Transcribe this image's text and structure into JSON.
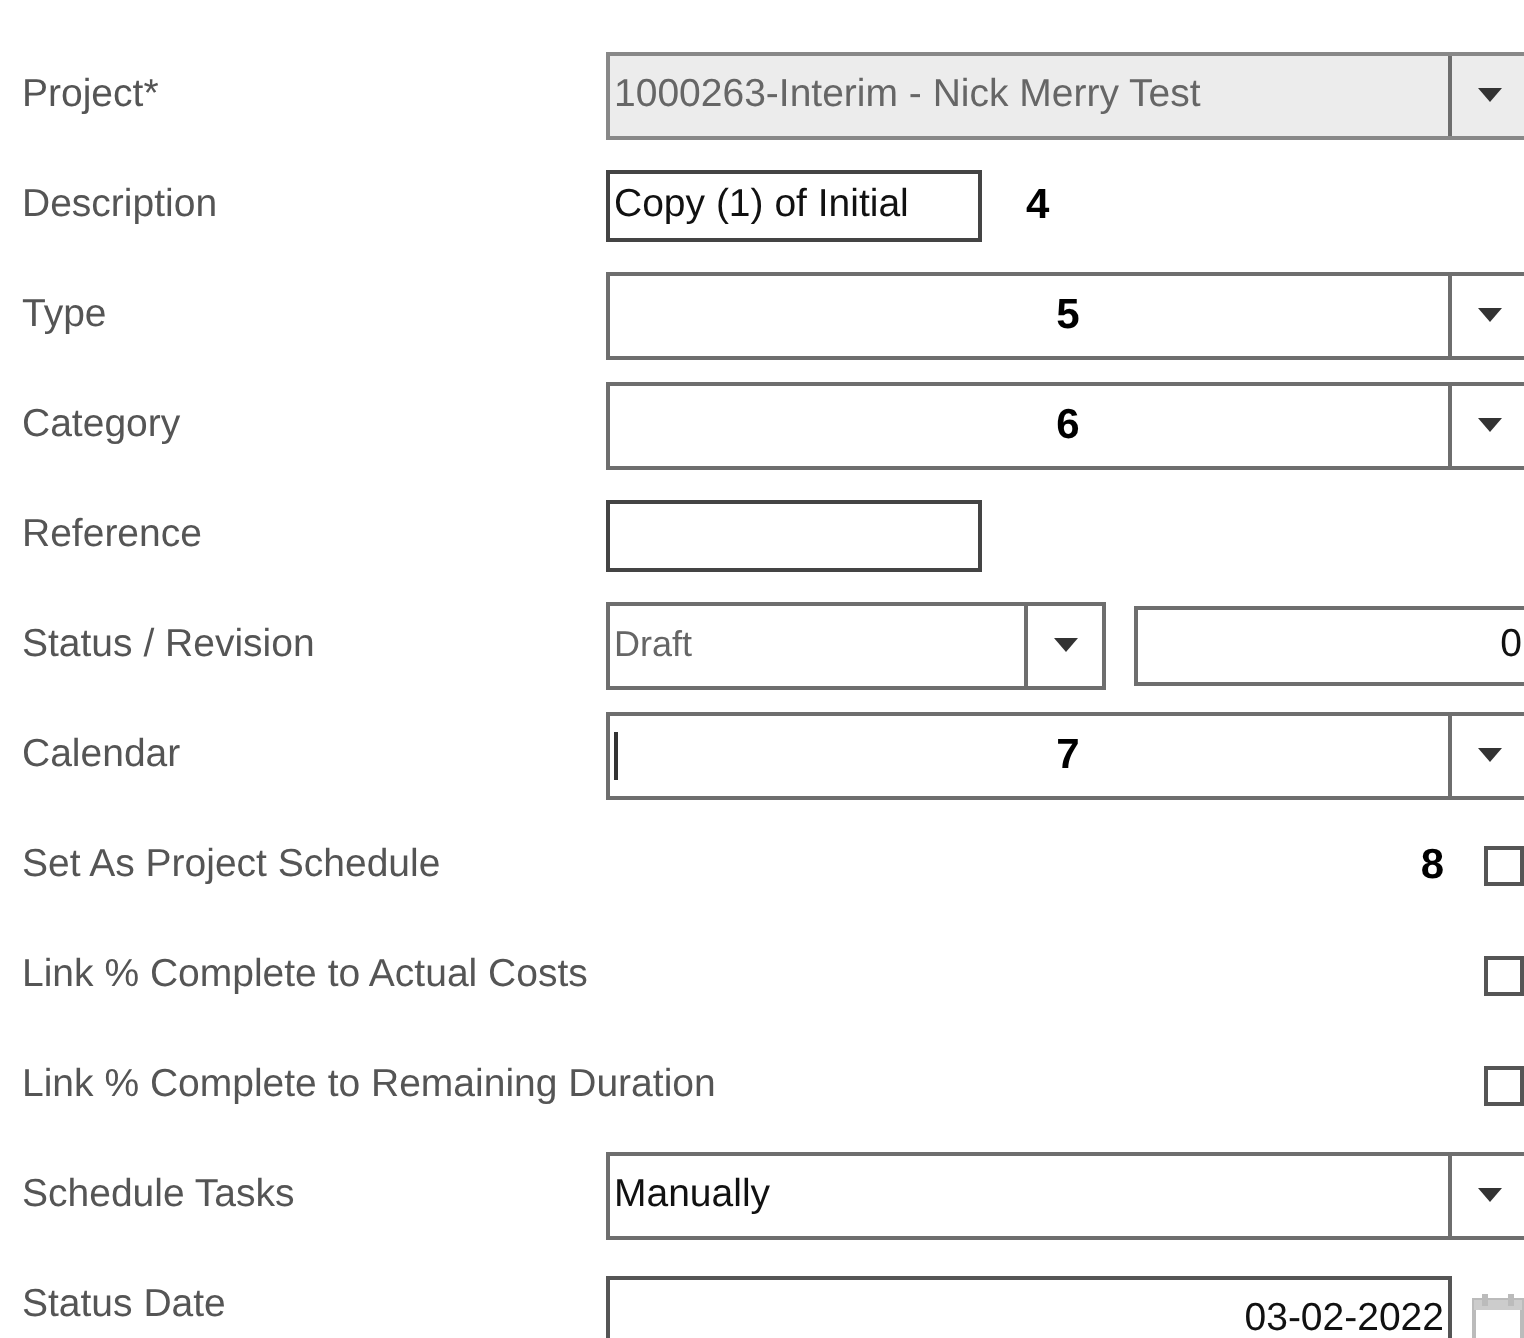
{
  "rows": [
    {
      "kind": "select",
      "label": "Project*",
      "value": "1000263-Interim  - Nick Merry Test",
      "disabled": true
    },
    {
      "kind": "text",
      "label": "Description",
      "value": "Copy (1) of Initial ",
      "marker": "4"
    },
    {
      "kind": "select",
      "label": "Type",
      "marker": "5",
      "disabled": false
    },
    {
      "kind": "select",
      "label": "Category",
      "marker": "6",
      "disabled": false
    },
    {
      "kind": "text",
      "label": "Reference"
    },
    {
      "kind": "status",
      "label": "Status / Revision",
      "value": "Draft",
      "revision": "0"
    },
    {
      "kind": "select",
      "label": "Calendar",
      "marker": "7",
      "focused": true,
      "disabled": false
    },
    {
      "kind": "checkbox",
      "label": "Set As Project Schedule",
      "marker": "8",
      "checked": false
    },
    {
      "kind": "checkbox",
      "label": "Link % Complete to Actual Costs",
      "checked": false
    },
    {
      "kind": "checkbox",
      "label": "Link % Complete to Remaining Duration",
      "checked": false
    },
    {
      "kind": "select",
      "label": "Schedule Tasks",
      "value": "Manually",
      "disabled": false
    },
    {
      "kind": "date",
      "label": "Status Date",
      "value": "03-02-2022"
    }
  ]
}
